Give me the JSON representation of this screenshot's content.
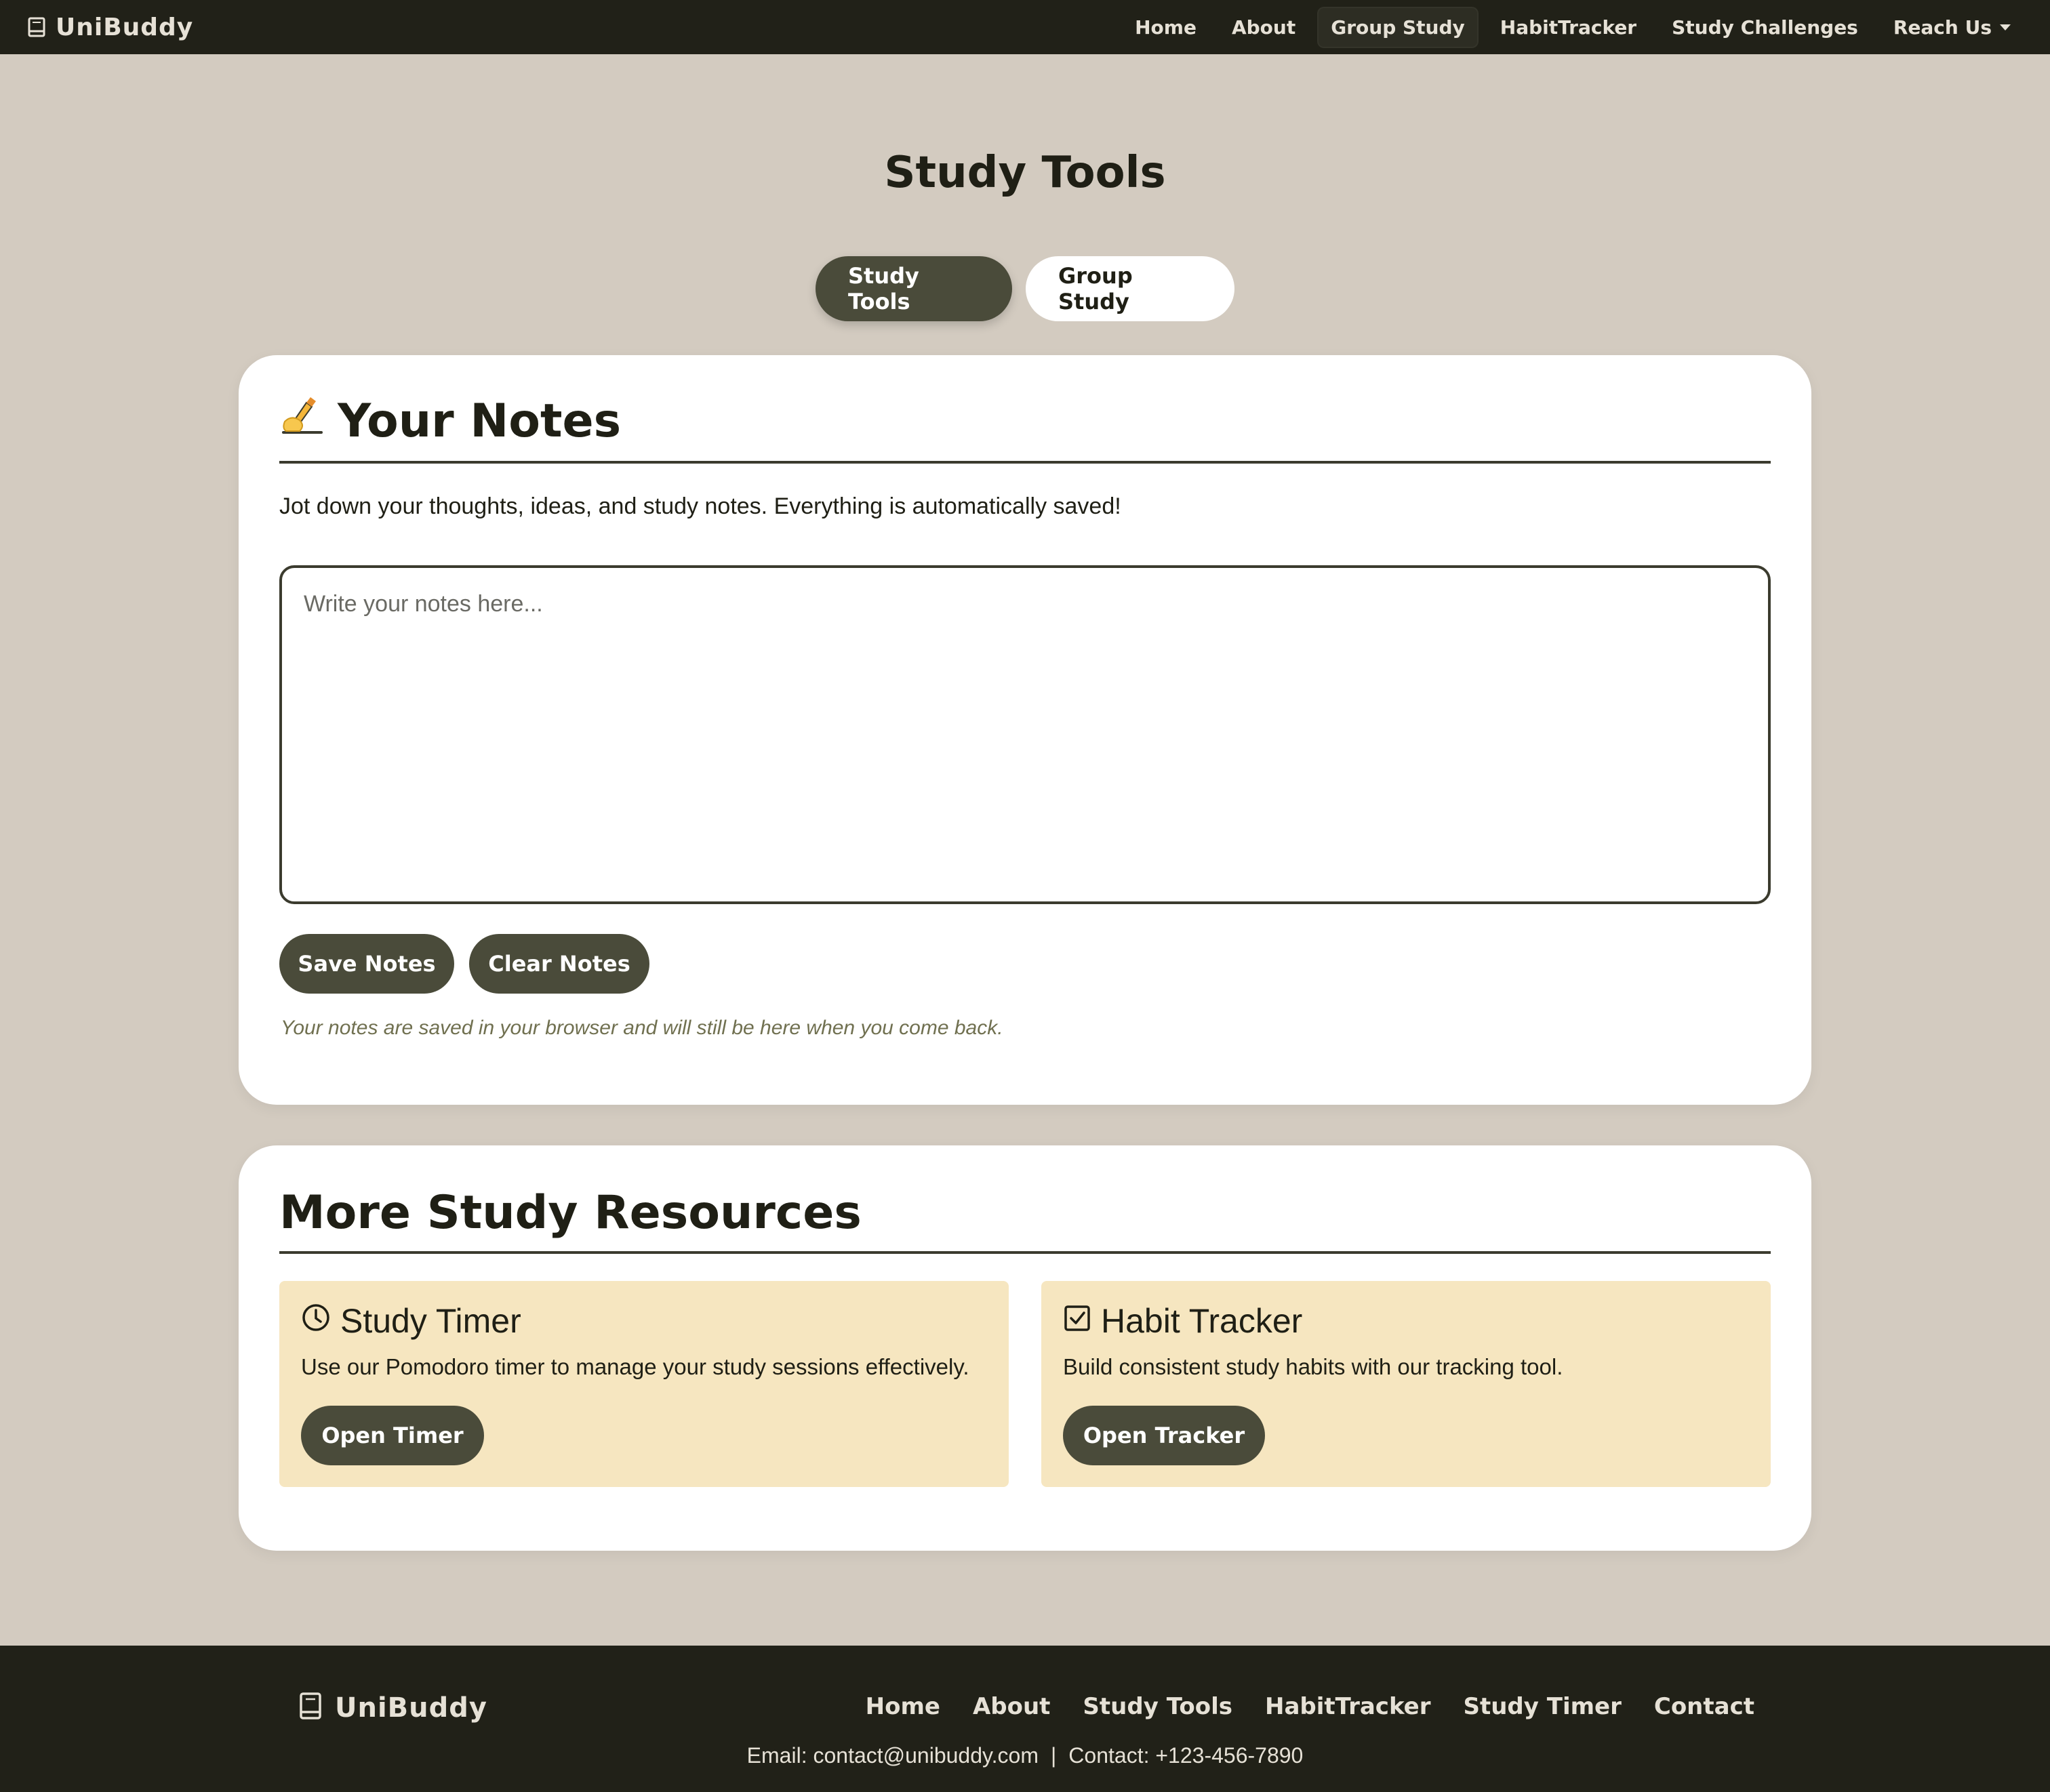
{
  "nav": {
    "brand": "UniBuddy",
    "links": [
      "Home",
      "About",
      "Group Study",
      "HabitTracker",
      "Study Challenges",
      "Reach Us"
    ]
  },
  "page": {
    "title": "Study Tools",
    "tabs": [
      "Study Tools",
      "Group Study"
    ]
  },
  "notes": {
    "heading": "Your Notes",
    "description": "Jot down your thoughts, ideas, and study notes. Everything is automatically saved!",
    "placeholder": "Write your notes here...",
    "save_label": "Save Notes",
    "clear_label": "Clear Notes",
    "hint": "Your notes are saved in your browser and will still be here when you come back."
  },
  "resources": {
    "heading": "More Study Resources",
    "items": [
      {
        "title": "Study Timer",
        "description": "Use our Pomodoro timer to manage your study sessions effectively.",
        "button": "Open Timer"
      },
      {
        "title": "Habit Tracker",
        "description": "Build consistent study habits with our tracking tool.",
        "button": "Open Tracker"
      }
    ]
  },
  "footer": {
    "brand": "UniBuddy",
    "links": [
      "Home",
      "About",
      "Study Tools",
      "HabitTracker",
      "Study Timer",
      "Contact"
    ],
    "email": "Email: contact@unibuddy.com",
    "separator": "|",
    "phone": "Contact: +123-456-7890"
  },
  "colors": {
    "page_bg": "#d3cbc0",
    "dark": "#212118",
    "button": "#4a4b3a",
    "resource_bg": "#f6e6c0"
  }
}
